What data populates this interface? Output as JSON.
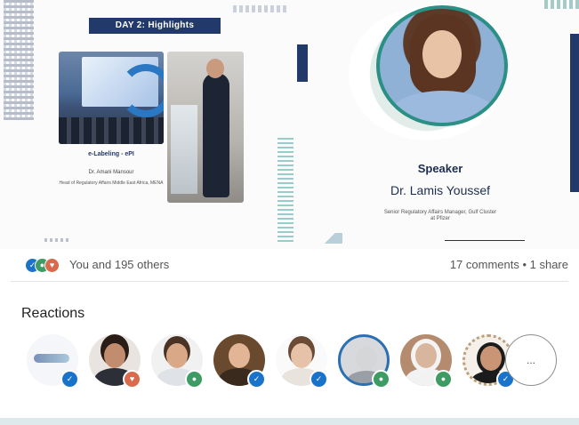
{
  "post": {
    "banner": "DAY 2: Highlights",
    "photo_caption_title": "e-Labeling - ePI",
    "photo_caption_name": "Dr. Amani Mansour",
    "photo_caption_role": "Head of Regulatory Affairs Middle East Africa, MENA",
    "speaker_label": "Speaker",
    "speaker_name": "Dr. Lamis Youssef",
    "speaker_role": "Senior Regulatory Affairs Manager, Gulf Cluster at Pfizer"
  },
  "social": {
    "reaction_icons": [
      "like-icon",
      "celebrate-icon",
      "love-icon"
    ],
    "likes_text": "You and 195 others",
    "comments_text": "17 comments • 1 share"
  },
  "reactions": {
    "title": "Reactions",
    "more_label": "...",
    "people": [
      {
        "badge": "like",
        "color": "#1a73c9"
      },
      {
        "badge": "love",
        "color": "#d96a4c"
      },
      {
        "badge": "celebrate",
        "color": "#3d9b63"
      },
      {
        "badge": "like",
        "color": "#1a73c9"
      },
      {
        "badge": "like",
        "color": "#1a73c9"
      },
      {
        "badge": "celebrate",
        "color": "#3d9b63"
      },
      {
        "badge": "celebrate",
        "color": "#3d9b63"
      },
      {
        "badge": "like",
        "color": "#1a73c9"
      },
      {
        "badge": "like",
        "color": "#1a73c9"
      }
    ]
  },
  "colors": {
    "navy": "#223a6a",
    "teal": "#2a8f85",
    "like": "#1a73c9",
    "celebrate": "#3d9b63",
    "love": "#d96a4c"
  }
}
